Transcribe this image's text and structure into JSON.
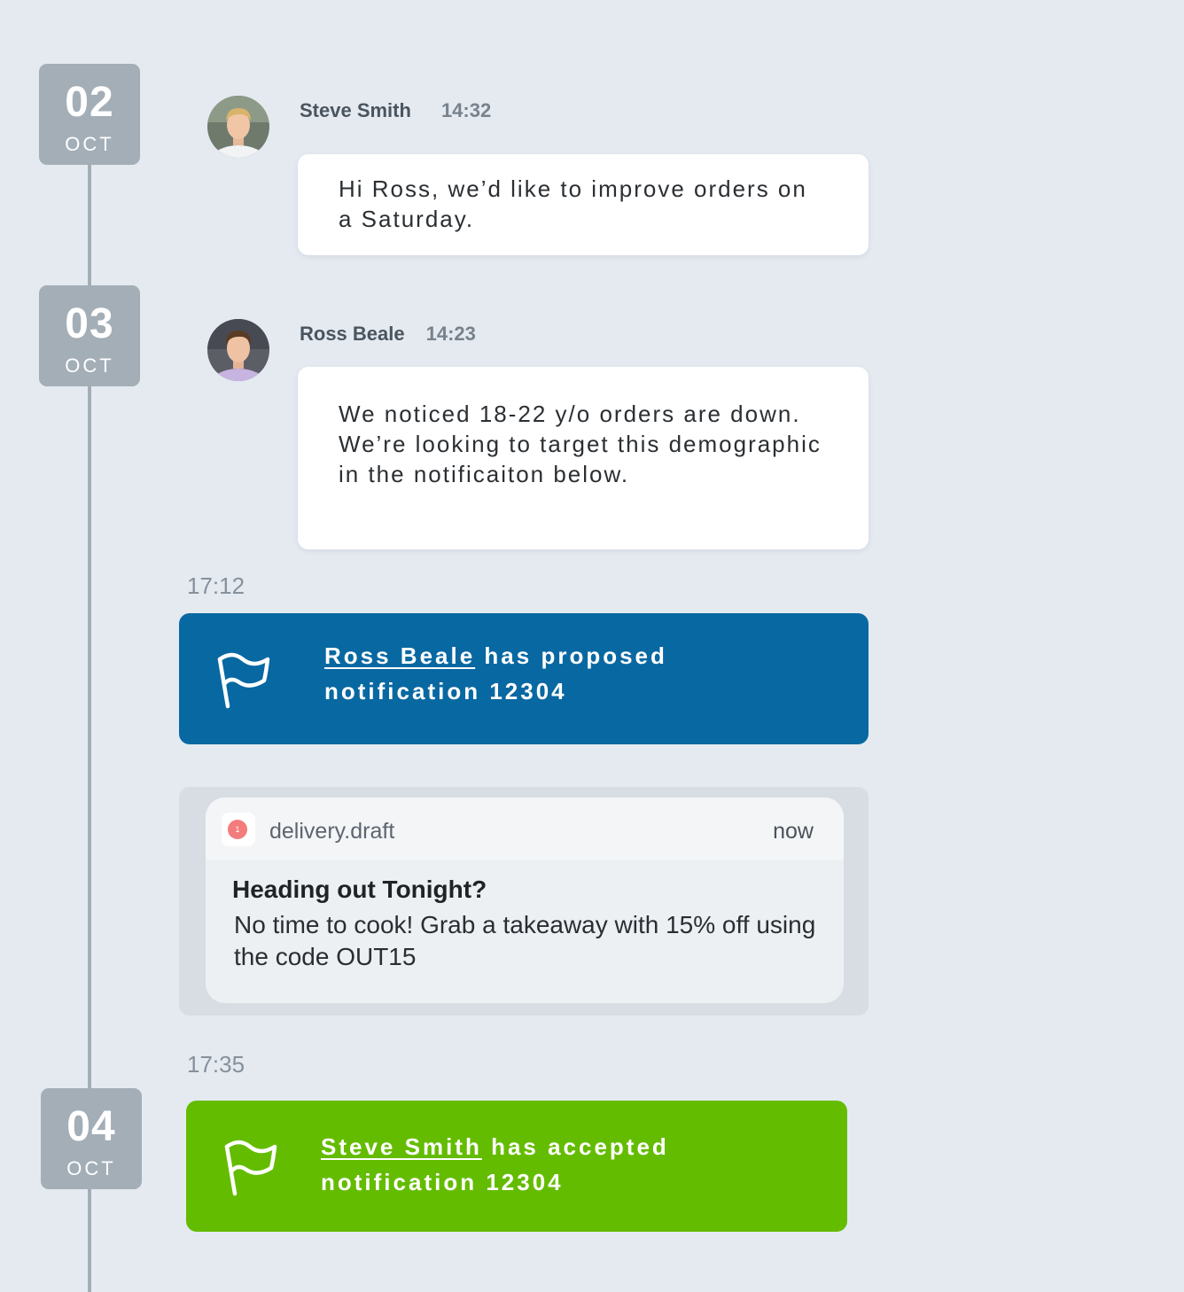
{
  "timeline": {
    "dates": [
      {
        "day": "02",
        "month": "OCT"
      },
      {
        "day": "03",
        "month": "OCT"
      },
      {
        "day": "04",
        "month": "OCT"
      }
    ]
  },
  "messages": [
    {
      "author": "Steve Smith",
      "time": "14:32",
      "text": "Hi Ross, we’d like to improve orders on a Saturday."
    },
    {
      "author": "Ross Beale",
      "time": "14:23",
      "text": "We noticed 18-22 y/o orders are down. We’re looking to target this demographic in the notificaiton below."
    }
  ],
  "events": [
    {
      "time": "17:12",
      "actor": "Ross Beale",
      "action": "has proposed",
      "subject": "notification 12304",
      "color": "#0868a2"
    },
    {
      "time": "17:35",
      "actor": "Steve Smith",
      "action": "has accepted",
      "subject": "notification 12304",
      "color": "#64bc00"
    }
  ],
  "notification_preview": {
    "app_name": "delivery.draft",
    "badge_count": "1",
    "when": "now",
    "title": "Heading out Tonight?",
    "body": "No time to cook! Grab a takeaway with 15% off using the code OUT15",
    "icon": "chat-bubble-icon"
  },
  "colors": {
    "background": "#e4eaf0",
    "timeline": "#a3aeb7",
    "proposed": "#0868a2",
    "accepted": "#64bc00"
  }
}
